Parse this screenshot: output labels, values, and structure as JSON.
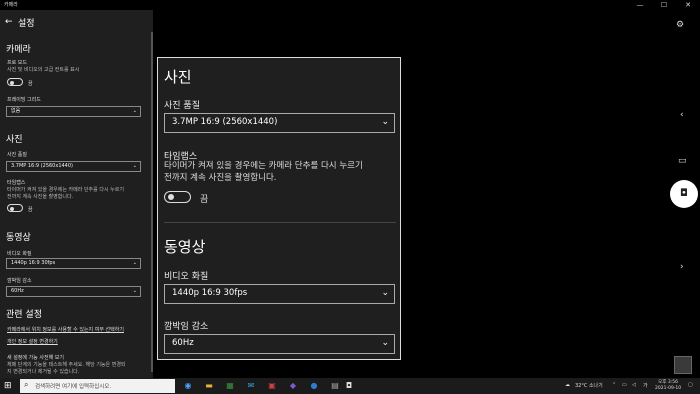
{
  "window": {
    "app_title": "카메라",
    "minimize": "—",
    "maximize": "☐",
    "close": "✕"
  },
  "panel": {
    "back_icon": "←",
    "title": "설정",
    "camera": {
      "heading": "카메라",
      "pro_mode_label": "프로 모드",
      "pro_mode_desc": "사진 및 비디오의 고급 컨트롤 표시",
      "pro_mode_state": "끔",
      "framing_label": "프레이밍 그리드",
      "framing_value": "없음"
    },
    "photo": {
      "heading": "사진",
      "quality_label": "사진 품질",
      "quality_value": "3.7MP 16:9 (2560x1440)",
      "timelapse_label": "타임랩스",
      "timelapse_desc1": "타이머가 켜져 있을 경우에는 카메라 단추를 다시 누르기",
      "timelapse_desc2": "전까지 계속 사진을 촬영합니다.",
      "timelapse_state": "끔"
    },
    "video": {
      "heading": "동영상",
      "quality_label": "비디오 화질",
      "quality_value": "1440p 16:9 30fps",
      "flicker_label": "깜박임 감소",
      "flicker_value": "60Hz"
    },
    "related": {
      "heading": "관련 설정",
      "link1": "카메라에서 위치 정보를 사용할 수 있는지 여부 선택하기",
      "link2": "개인 정보 설정 변경하기",
      "new_title": "새 설정에 가능 사전해 보기",
      "new_desc1": "체페 단계의 기능을 테스트해 주세요. 해당 기능은 변경되",
      "new_desc2": "지 변경되거나 제거될 수 있습니다."
    }
  },
  "zoom": {
    "photo_heading": "사진",
    "quality_label": "사진 품질",
    "quality_value": "3.7MP 16:9 (2560x1440)",
    "timelapse_label": "타임랩스",
    "timelapse_desc1": "타이머가 켜져 있을 경우에는 카메라 단추를 다시 누르기",
    "timelapse_desc2": "전까지 계속 사진을 촬영합니다.",
    "timelapse_state": "끔",
    "video_heading": "동영상",
    "video_quality_label": "비디오 화질",
    "video_quality_value": "1440p 16:9 30fps",
    "flicker_label": "깜박임 감소",
    "flicker_value": "60Hz"
  },
  "camera_controls": {
    "settings_icon": "gear-icon",
    "collapse_icon": "‹",
    "video_icon": "▭",
    "photo_icon": "◘"
  },
  "taskbar": {
    "start_icon": "⊞",
    "search_placeholder": "검색하려면 여기에 입력하십시오.",
    "weather": "32°C 소나기",
    "ime": "가",
    "time": "오후 3:56",
    "date": "2021-09-10"
  }
}
